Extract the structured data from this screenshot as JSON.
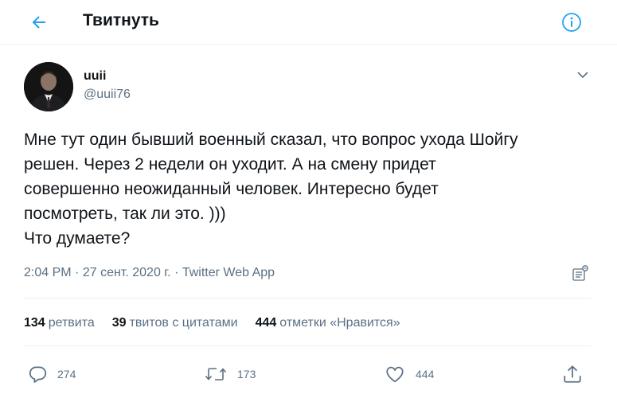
{
  "header": {
    "title": "Твитнуть",
    "back_icon": "arrow-left-icon",
    "info_icon": "info-icon",
    "accent_color": "#1da1f2"
  },
  "author": {
    "display_name": "uuii",
    "handle": "@uuii76"
  },
  "tweet": {
    "lines": [
      "Мне тут один бывший военный сказал, что вопрос ухода Шойгу",
      "решен. Через 2 недели он уходит. А на смену придет",
      "совершенно неожиданный человек. Интересно будет",
      "посмотреть, так ли это. )))",
      "Что думаете?"
    ],
    "time": "2:04 PM",
    "date": "27 сент. 2020 г.",
    "source": "Twitter Web App",
    "separator": "·"
  },
  "stats": [
    {
      "count": "134",
      "label": "ретвита"
    },
    {
      "count": "39",
      "label": "твитов с цитатами"
    },
    {
      "count": "444",
      "label": "отметки «Нравится»"
    }
  ],
  "actions": {
    "reply_count": "274",
    "retweet_count": "173",
    "like_count": "444"
  },
  "colors": {
    "text_primary": "#0f1419",
    "text_secondary": "#5b7083",
    "divider": "#ebeef0"
  }
}
